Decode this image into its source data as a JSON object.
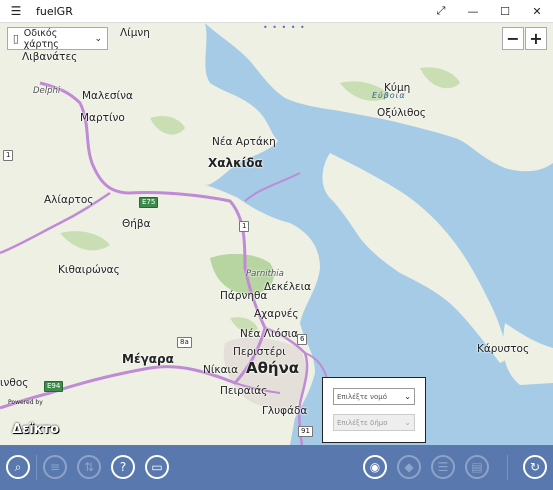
{
  "window": {
    "title": "fuelGR",
    "menu_icon": "hamburger-icon",
    "fullscreen_icon": "fullscreen-icon",
    "minimize_icon": "minimize-icon",
    "maximize_icon": "maximize-icon",
    "close_icon": "close-icon"
  },
  "map": {
    "type_selector": {
      "selected": "Οδικός χάρτης",
      "icon": "phone-icon"
    },
    "zoom_out": "−",
    "zoom_in": "+",
    "labels": [
      "Λίμνη",
      "Λιβανάτες",
      "Delphi",
      "Μαλεσίνα",
      "Μαρτίνο",
      "Εύβοια",
      "Κύμη",
      "Οξύλιθος",
      "Νέα Αρτάκη",
      "Χαλκίδα",
      "Αλίαρτος",
      "Θήβα",
      "Κιθαιρώνας",
      "Parnithia",
      "Πάρνηθα",
      "Δεκέλεια",
      "Αχαρνές",
      "Νέα Λιόσια",
      "Περιστέρι",
      "Μέγαρα",
      "Νίκαια",
      "Αθήνα",
      "Πειραιάς",
      "Γλυφάδα",
      "Κάρυστος",
      "ινθος"
    ],
    "shields": [
      "E75",
      "1",
      "1",
      "8a",
      "6",
      "E94",
      "91"
    ]
  },
  "filter_popup": {
    "prefecture_placeholder": "Επιλέξτε νομό",
    "municipality_placeholder": "Επιλέξτε δήμο"
  },
  "branding": {
    "powered_by": "Powered by",
    "logo": "Δεїкто"
  },
  "appbar": {
    "search_icon": "search-icon",
    "list_icon": "list-lines-icon",
    "sort_icon": "sort-icon",
    "help_icon": "help-icon",
    "chat_icon": "chat-icon",
    "globe_icon": "globe-icon",
    "tag_icon": "tag-icon",
    "details_icon": "details-list-icon",
    "news_icon": "news-icon",
    "refresh_icon": "refresh-icon"
  },
  "colors": {
    "appbar": "#5978ae",
    "sea": "#a5cbe6",
    "land": "#eef0e4",
    "highway": "#c08ad6",
    "forest": "#b7d5a0"
  }
}
